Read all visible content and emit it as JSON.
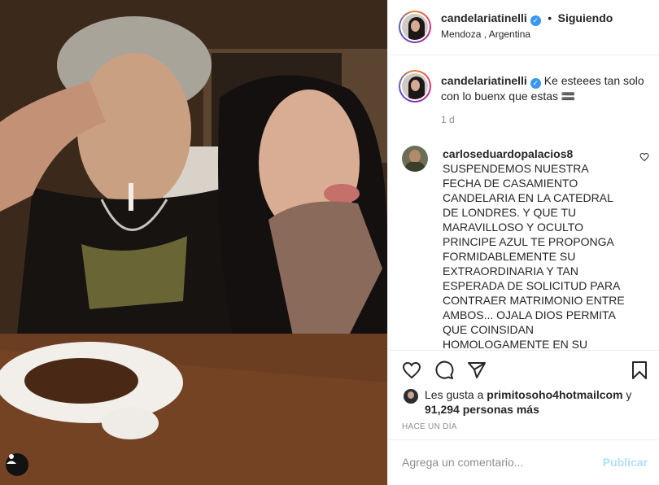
{
  "header": {
    "username": "candelariatinelli",
    "separator": "•",
    "follow_status": "Siguiendo",
    "location": "Mendoza , Argentina"
  },
  "caption": {
    "username": "candelariatinelli",
    "text": "Ke esteees tan solo con lo buenx que estas 🟰",
    "time": "1 d"
  },
  "comments": [
    {
      "username": "carloseduardopalacios8",
      "text": "SUSPENDEMOS NUESTRA FECHA DE CASAMIENTO CANDELARIA EN LA CATEDRAL DE LONDRES. Y QUE TU MARAVILLOSO Y OCULTO PRINCIPE AZUL TE PROPONGA FORMIDABLEMENTE SU EXTRAORDINARIA Y TAN ESPERADA DE SOLICITUD PARA CONTRAER MATRIMONIO ENTRE AMBOS... OJALA DIOS PERMITA QUE COINSIDAN HOMOLOGAMENTE EN SU DETERMINACION"
    }
  ],
  "likes": {
    "prefix": "Les gusta a ",
    "user": "primitosoho4hotmailcom",
    "middle": " y",
    "count": "91,294 personas más"
  },
  "date": "HACE UN DÍA",
  "add_comment": {
    "placeholder": "Agrega un comentario...",
    "publish": "Publicar"
  },
  "icons": {
    "like": "heart-icon",
    "comment": "comment-icon",
    "share": "paper-plane-icon",
    "save": "bookmark-icon",
    "tag": "user-tag-icon",
    "verified": "verified-badge-icon"
  },
  "colors": {
    "verified": "#3897f0",
    "publish_disabled": "#b2dffc",
    "muted": "#8e8e8e"
  }
}
